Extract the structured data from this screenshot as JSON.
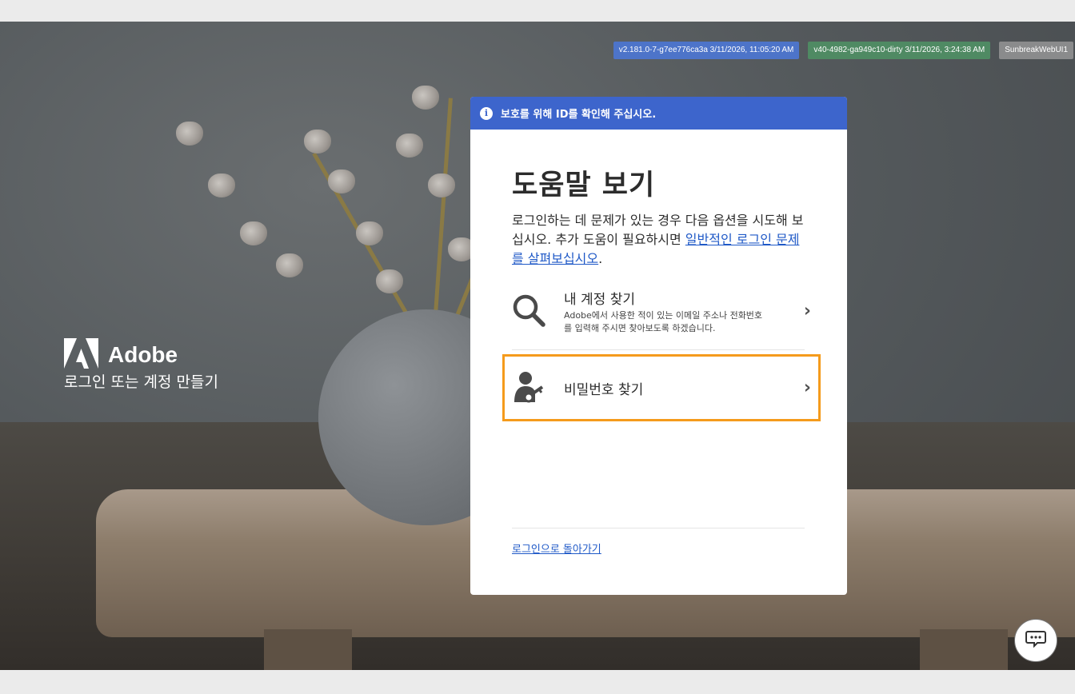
{
  "version_badges": [
    "v2.181.0-7-g7ee776ca3a 3/11/2026, 11:05:20 AM",
    "v40-4982-ga949c10-dirty 3/11/2026, 3:24:38 AM",
    "SunbreakWebUI1"
  ],
  "brand": {
    "name": "Adobe",
    "subtitle": "로그인 또는 계정 만들기"
  },
  "banner": {
    "text": "보호를 위해 ID를 확인해 주십시오."
  },
  "card": {
    "title": "도움말 보기",
    "description_before": "로그인하는 데 문제가 있는 경우 다음 옵션을 시도해 보십시오. 추가 도움이 필요하시면 ",
    "description_link": "일반적인 로그인 문제를 살펴보십시오",
    "description_after": ".",
    "options": [
      {
        "title": "내 계정 찾기",
        "description": "Adobe에서 사용한 적이 있는 이메일 주소나 전화번호를 입력해 주시면 찾아보도록 하겠습니다.",
        "icon": "search-icon"
      },
      {
        "title": "비밀번호 찾기",
        "icon": "user-key-icon"
      }
    ],
    "back_link": "로그인으로 돌아가기"
  },
  "colors": {
    "banner": "#3d65cc",
    "highlight": "#f59b1c",
    "link": "#1f59c7"
  }
}
